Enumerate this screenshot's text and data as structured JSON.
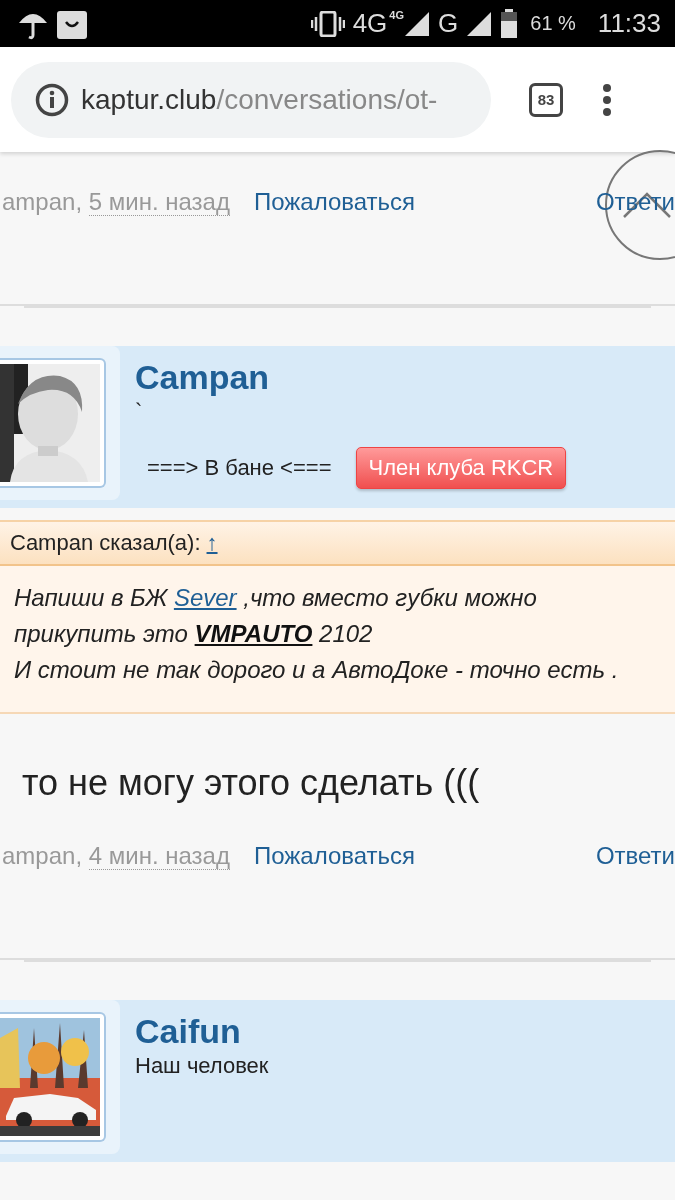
{
  "status_bar": {
    "network_primary": "4G",
    "network_badge": "4G",
    "network_secondary": "G",
    "battery": "61 %",
    "time": "11:33"
  },
  "browser": {
    "url_host": "kaptur.club",
    "url_path": "/conversations/ot-",
    "tab_count": "83"
  },
  "posts": [
    {
      "kind": "footer",
      "author": "ampan,",
      "time": "5 мин. назад",
      "report": "Пожаловаться",
      "reply": "Ответи"
    },
    {
      "kind": "user",
      "name": "Campan",
      "title": "`",
      "status": "===> В бане <===",
      "badge": "Член клуба RKCR"
    },
    {
      "kind": "quote",
      "header": "Campan сказал(а):",
      "header_link": "↑",
      "paragraphs": [
        [
          {
            "kind": "text",
            "text": "Напиши в БЖ "
          },
          {
            "kind": "link",
            "text": "Sever"
          },
          {
            "kind": "text",
            "text": " ,что вместо губки можно прикупить это "
          },
          {
            "kind": "strong-link",
            "text": "VMPAUTO"
          },
          {
            "kind": "text",
            "text": " 2102"
          }
        ],
        [
          {
            "kind": "text",
            "text": "И стоит не так дорого и а АвтоДоке - точно есть ."
          }
        ]
      ]
    },
    {
      "kind": "message",
      "text": "то не могу этого сделать ((("
    },
    {
      "kind": "footer",
      "author": "ampan,",
      "time": "4 мин. назад",
      "report": "Пожаловаться",
      "reply": "Ответи"
    },
    {
      "kind": "user",
      "name": "Caifun",
      "title": "Наш человек"
    }
  ]
}
